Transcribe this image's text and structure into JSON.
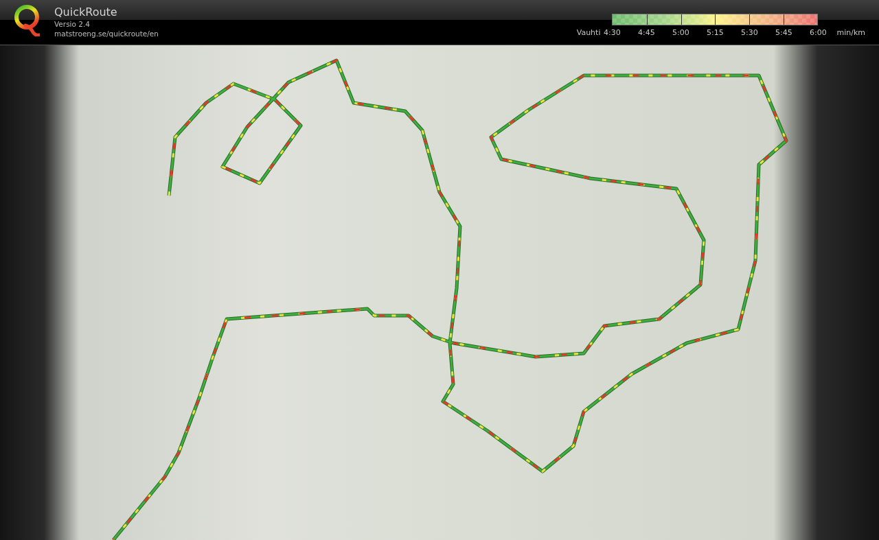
{
  "header": {
    "app_name": "QuickRoute",
    "version": "Versio 2.4",
    "url": "matstroeng.se/quickroute/en"
  },
  "pace_legend": {
    "label": "Vauhti",
    "ticks": [
      "4:30",
      "4:45",
      "5:00",
      "5:15",
      "5:30",
      "5:45",
      "6:00"
    ],
    "unit": "min/km"
  }
}
